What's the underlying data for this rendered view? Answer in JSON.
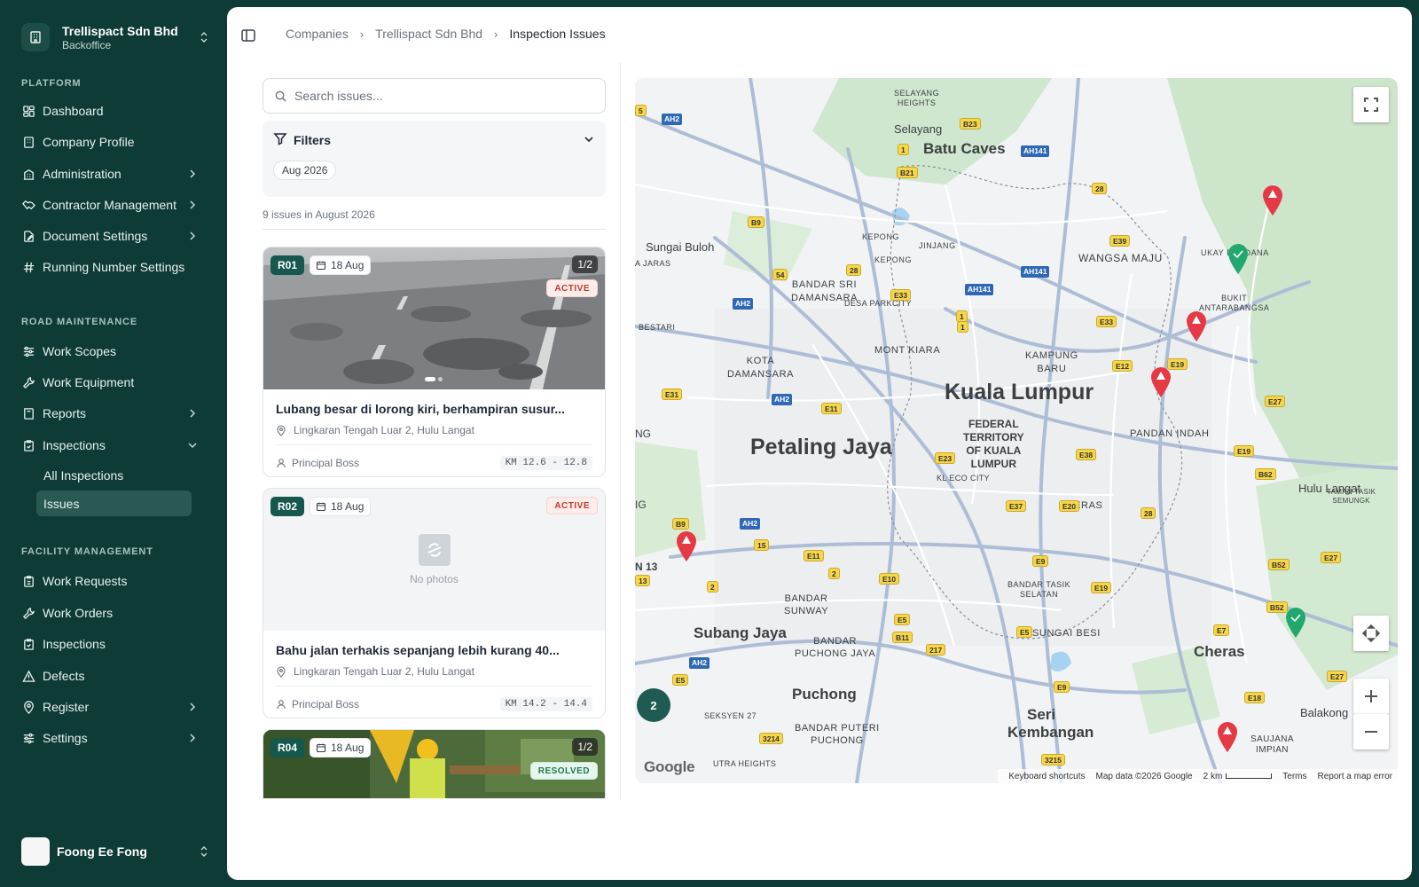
{
  "org": {
    "name": "Trellispact Sdn Bhd",
    "sub": "Backoffice"
  },
  "sidebar": {
    "platform_label": "PLATFORM",
    "platform": [
      {
        "label": "Dashboard"
      },
      {
        "label": "Company Profile"
      },
      {
        "label": "Administration"
      },
      {
        "label": "Contractor Management"
      },
      {
        "label": "Document Settings"
      },
      {
        "label": "Running Number Settings"
      }
    ],
    "road_label": "ROAD MAINTENANCE",
    "road": [
      {
        "label": "Work Scopes"
      },
      {
        "label": "Work Equipment"
      },
      {
        "label": "Reports"
      },
      {
        "label": "Inspections"
      }
    ],
    "inspections_sub": [
      {
        "label": "All Inspections"
      },
      {
        "label": "Issues"
      }
    ],
    "facility_label": "FACILITY MANAGEMENT",
    "facility": [
      {
        "label": "Work Requests"
      },
      {
        "label": "Work Orders"
      },
      {
        "label": "Inspections"
      },
      {
        "label": "Defects"
      },
      {
        "label": "Register"
      },
      {
        "label": "Settings"
      }
    ]
  },
  "user": {
    "name": "Foong Ee Fong"
  },
  "breadcrumb": [
    "Companies",
    "Trellispact Sdn Bhd",
    "Inspection Issues"
  ],
  "search": {
    "placeholder": "Search issues..."
  },
  "filters": {
    "label": "Filters",
    "chip": "Aug 2026"
  },
  "count_text": "9 issues in August 2026",
  "issues": [
    {
      "code": "R01",
      "date": "18 Aug",
      "pager": "1/2",
      "status": "ACTIVE",
      "title": "Lubang besar di lorong kiri, berhampiran susur...",
      "location": "Lingkaran Tengah Luar 2, Hulu Langat",
      "person": "Principal Boss",
      "km": "KM 12.6 - 12.8"
    },
    {
      "code": "R02",
      "date": "18 Aug",
      "status": "ACTIVE",
      "no_photo": "No photos",
      "title": "Bahu jalan terhakis sepanjang lebih kurang 40...",
      "location": "Lingkaran Tengah Luar 2, Hulu Langat",
      "person": "Principal Boss",
      "km": "KM 14.2 - 14.4"
    },
    {
      "code": "R04",
      "date": "18 Aug",
      "pager": "1/2",
      "status": "RESOLVED"
    }
  ],
  "map": {
    "cluster_count": "2",
    "cities": {
      "kl": "Kuala Lumpur",
      "pj": "Petaling Jaya",
      "subang": "Subang Jaya",
      "puchong": "Puchong",
      "cheras": "Cheras",
      "seri": "Seri",
      "kembangan": "Kembangan",
      "batu_caves": "Batu Caves",
      "selayang": "Selayang",
      "hulu_langat": "Hulu Langat",
      "sungai_buloh": "Sungai Buloh",
      "balakong": "Balakong"
    },
    "areas": {
      "ft1": "FEDERAL",
      "ft2": "TERRITORY",
      "ft3": "OF KUALA",
      "ft4": "LUMPUR",
      "kota1": "KOTA",
      "kota2": "DAMANSARA",
      "bsd1": "BANDAR SRI",
      "bsd2": "DAMANSARA",
      "mont_kiara": "MONT KIARA",
      "kepong1": "KEPONG",
      "kepong2": "KEPONG",
      "jinjang": "JINJANG",
      "wangsa_maju": "WANGSA MAJU",
      "kampung1": "KAMPUNG",
      "kampung2": "BARU",
      "pandan_indah": "PANDAN INDAH",
      "ukay": "UKAY PERDANA",
      "bukit1": "BUKIT",
      "bukit2": "ANTARABANGSA",
      "desa": "DESA PARKCITY",
      "selayang_heights1": "SELAYANG",
      "selayang_heights2": "HEIGHTS",
      "bestari": "BESTARI",
      "jaras": "A JARAS",
      "bandar_sunway1": "BANDAR",
      "bandar_sunway2": "SUNWAY",
      "bpj1": "BANDAR",
      "bpj2": "PUCHONG JAYA",
      "bpp1": "BANDAR PUTERI",
      "bpp2": "PUCHONG",
      "btl1": "BANDAR TASIK",
      "btl2": "SELATAN",
      "sungai_besi": "SUNGAI BESI",
      "kl_eco": "KL ECO CITY",
      "seksyen": "SEKSYEN 27",
      "putra": "UTRA HEIGHTS",
      "saujana1": "SAUJANA",
      "saujana2": "IMPIAN",
      "taman1": "TAMAN TASIK",
      "taman2": "SEMUNGK",
      "n13": "N 13",
      "ng": "NG",
      "g": "IG",
      "cheras_small": "CHERAS"
    },
    "shields": [
      "AH2",
      "B23",
      "B21",
      "B9",
      "AH2",
      "54",
      "28",
      "E33",
      "AH141",
      "AH141",
      "1",
      "E39",
      "28",
      "AH141",
      "E33",
      "E12",
      "E19",
      "E27",
      "E19",
      "B62",
      "E31",
      "AH2",
      "E11",
      "E23",
      "E38",
      "E37",
      "E20",
      "28",
      "B9",
      "AH2",
      "15",
      "E11",
      "2",
      "E10",
      "E9",
      "E19",
      "B52",
      "E27",
      "B52",
      "E7",
      "E27",
      "E5",
      "B11",
      "217",
      "E5",
      "E9",
      "E18",
      "E5",
      "AH2",
      "3214",
      "3215",
      "1",
      "1",
      "5",
      "2",
      "13"
    ],
    "footer": {
      "shortcuts": "Keyboard shortcuts",
      "data": "Map data ©2026 Google",
      "scale": "2 km",
      "terms": "Terms",
      "report": "Report a map error"
    },
    "logo": "Google"
  }
}
